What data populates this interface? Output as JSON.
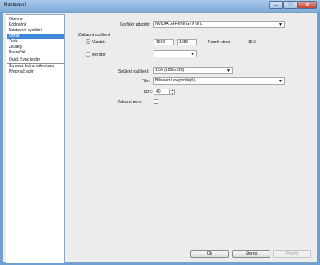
{
  "window": {
    "title": "Nastavení...",
    "controls": {
      "minimize": "–",
      "maximize": "□",
      "close": "✕"
    }
  },
  "sidebar": {
    "items": [
      {
        "label": "Obecné"
      },
      {
        "label": "Kódování"
      },
      {
        "label": "Nastavení vysílání"
      },
      {
        "label": "Obraz"
      },
      {
        "label": "Zvuk"
      },
      {
        "label": "Zkratky"
      },
      {
        "label": "Pokročilé"
      },
      {
        "label": "Quick Sync kodér"
      },
      {
        "label": "Šumová brána mikrofonu"
      },
      {
        "label": "Přepínač scén"
      }
    ],
    "selected_index": 3
  },
  "video_settings": {
    "adapter_label": "Grafický adaptér:",
    "adapter_value": "NVIDIA GeForce GTX 970",
    "base_resolution_label": "Základní rozlišení:",
    "custom_label": "Vlastní:",
    "width_value": "1920",
    "height_value": "1080",
    "aspect_ratio_label": "Poměr stran:",
    "aspect_ratio_value": "16:9",
    "monitor_label": "Monitor:",
    "downscale_label": "Snížení rozlišení:",
    "downscale_value": "1.50  (1280x720)",
    "filter_label": "Filtr:",
    "filter_value": "Bilineární (nejrychlejší)",
    "fps_label": "FPS:",
    "fps_value": "40",
    "disable_aero_label": "Zakázat Aero:"
  },
  "buttons": {
    "ok": "Ok",
    "cancel": "Storno",
    "apply": "Použít"
  },
  "icons": {
    "dropdown": "▼",
    "spin_up": "▲",
    "spin_down": "▼"
  }
}
